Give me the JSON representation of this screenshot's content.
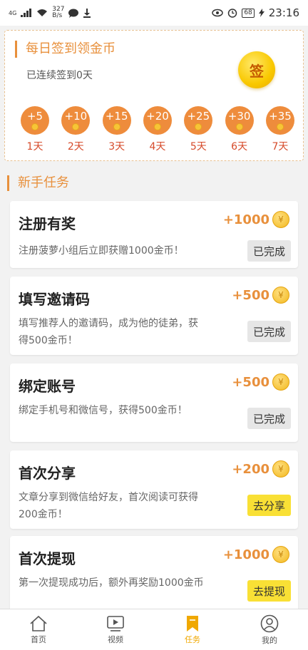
{
  "status_bar": {
    "network": "4G",
    "speed_value": "327",
    "speed_unit": "B/s",
    "battery": "68",
    "time": "23:16"
  },
  "checkin": {
    "title": "每日签到领金币",
    "subtitle": "已连续签到0天",
    "sign_label": "签",
    "days": [
      {
        "reward": "+5",
        "label": "1天"
      },
      {
        "reward": "+10",
        "label": "2天"
      },
      {
        "reward": "+15",
        "label": "3天"
      },
      {
        "reward": "+20",
        "label": "4天"
      },
      {
        "reward": "+25",
        "label": "5天"
      },
      {
        "reward": "+30",
        "label": "6天"
      },
      {
        "reward": "+35",
        "label": "7天"
      }
    ]
  },
  "tasks_section": {
    "title": "新手任务",
    "coin_symbol": "¥",
    "items": [
      {
        "name": "注册有奖",
        "reward": "+1000",
        "desc": "注册菠萝小组后立即获赠1000金币！",
        "button": "已完成"
      },
      {
        "name": "填写邀请码",
        "reward": "+500",
        "desc": "填写推荐人的邀请码，成为他的徒弟，获得500金币！",
        "button": "已完成"
      },
      {
        "name": "绑定账号",
        "reward": "+500",
        "desc": "绑定手机号和微信号，获得500金币！",
        "button": "已完成"
      },
      {
        "name": "首次分享",
        "reward": "+200",
        "desc": "文章分享到微信给好友，首次阅读可获得200金币！",
        "button": "去分享"
      },
      {
        "name": "首次提现",
        "reward": "+1000",
        "desc": "第一次提现成功后，额外再奖励1000金币",
        "button": "去提现"
      }
    ]
  },
  "tabbar": {
    "items": [
      {
        "label": "首页",
        "icon": "home-icon"
      },
      {
        "label": "视频",
        "icon": "video-icon"
      },
      {
        "label": "任务",
        "icon": "bookmark-icon"
      },
      {
        "label": "我的",
        "icon": "profile-icon"
      }
    ],
    "active_index": 2,
    "active_color": "#f0a800"
  },
  "colors": {
    "accent": "#e8903c",
    "day_circle": "#ee8c3c",
    "done_button": "#e6e6e6",
    "go_button": "#f9e035"
  }
}
